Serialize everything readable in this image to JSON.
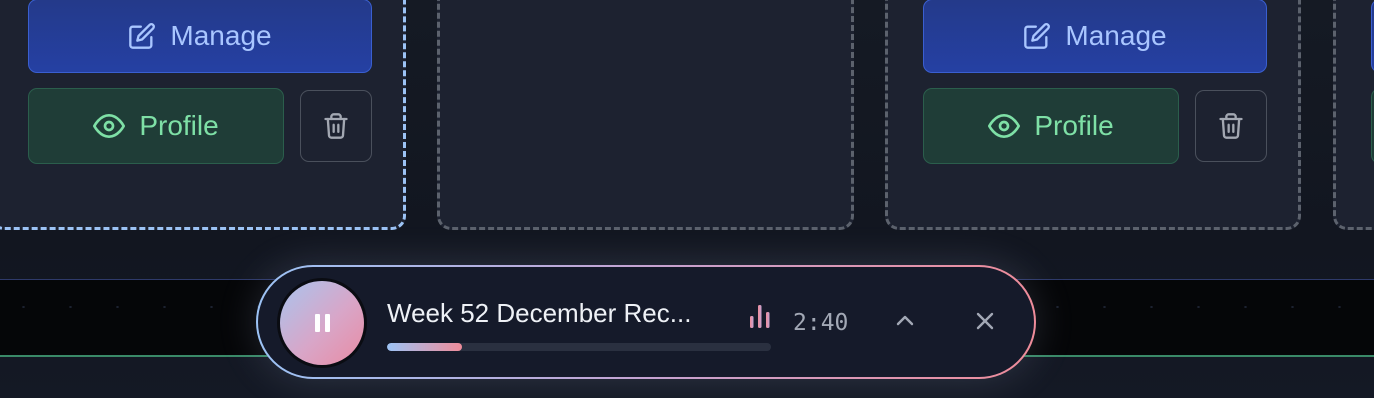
{
  "cards": [
    {
      "manage_label": "Manage",
      "profile_label": "Profile"
    },
    {
      "manage_label": "Manage",
      "profile_label": "Profile"
    }
  ],
  "player": {
    "track_title": "Week 52 December Rec...",
    "time": "2:40",
    "progress": 0.195,
    "icons": {
      "play_pause": "pause-icon",
      "eq": "equalizer-icon",
      "expand": "chevron-up-icon",
      "close": "close-icon"
    }
  },
  "colors": {
    "accent_blue": "#9cc3f5",
    "accent_pink": "#ef8c9a",
    "manage_bg": "#2540a3",
    "profile_bg": "#1f3d37",
    "profile_text": "#7ee0a6"
  }
}
